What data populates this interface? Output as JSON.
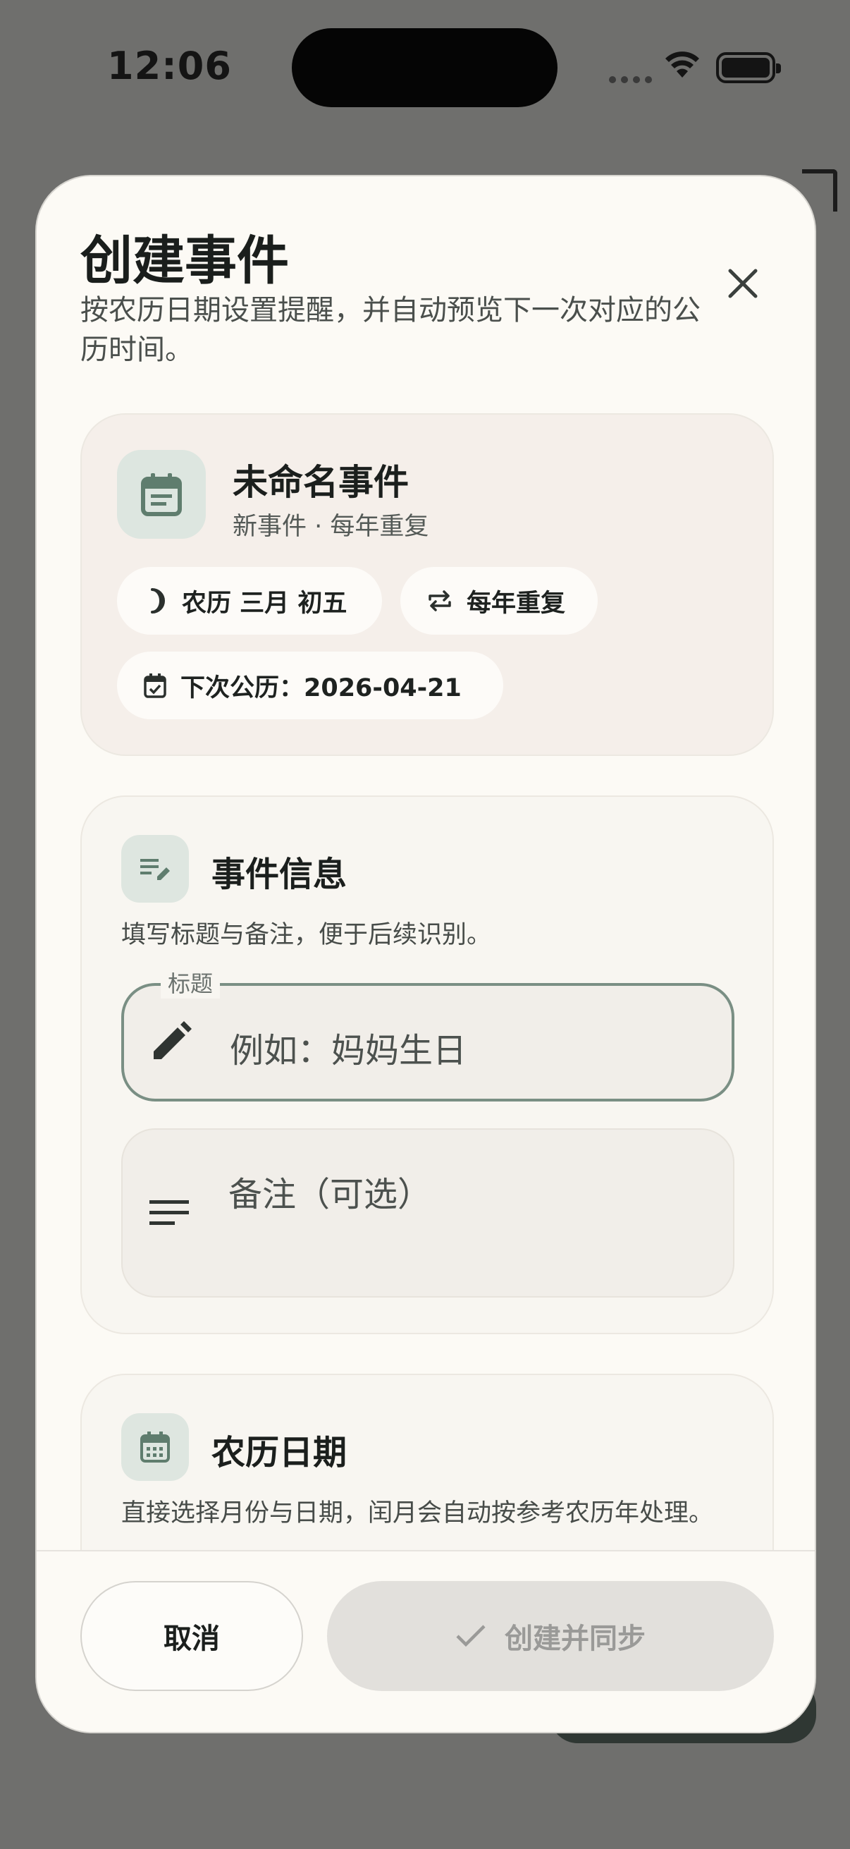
{
  "status_bar": {
    "time": "12:06"
  },
  "sheet": {
    "title": "创建事件",
    "subtitle": "按农历日期设置提醒，并自动预览下一次对应的公历时间。"
  },
  "preview": {
    "icon": "event-note-icon",
    "title": "未命名事件",
    "subtitle": "新事件 · 每年重复",
    "chips": {
      "lunar_date": "农历 三月 初五",
      "repeat": "每年重复",
      "next_solar": "下次公历：2026-04-21"
    }
  },
  "event_info": {
    "title": "事件信息",
    "description": "填写标题与备注，便于后续识别。",
    "title_field": {
      "label": "标题",
      "placeholder": "例如：妈妈生日",
      "value": ""
    },
    "note_field": {
      "placeholder": "备注（可选）",
      "value": ""
    }
  },
  "lunar_date": {
    "title": "农历日期",
    "description": "直接选择月份与日期，闰月会自动按参考农历年处理。"
  },
  "actions": {
    "cancel_label": "取消",
    "create_label": "创建并同步"
  },
  "colors": {
    "accent_green": "#5f7d6e",
    "sheet_bg": "#fcfaf5",
    "preview_bg": "#f5efea",
    "disabled_button": "#e2e0dc"
  }
}
